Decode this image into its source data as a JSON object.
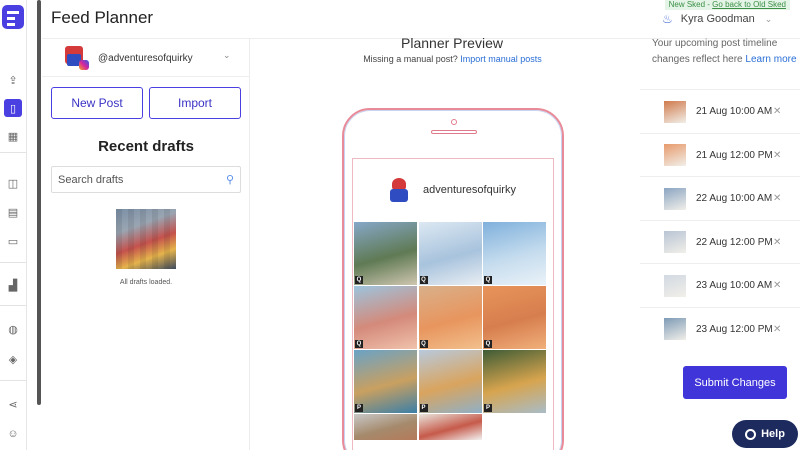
{
  "app": {
    "title": "Feed Planner"
  },
  "banner": {
    "prefix": "New Sked - ",
    "link": "Go back to Old Sked"
  },
  "user": {
    "name": "Kyra Goodman"
  },
  "account": {
    "handle": "@adventuresofquirky"
  },
  "drafts": {
    "new_post_label": "New Post",
    "import_label": "Import",
    "heading": "Recent drafts",
    "search_placeholder": "Search drafts",
    "loaded_text": "All drafts loaded."
  },
  "preview": {
    "heading": "Planner Preview",
    "missing_text": "Missing a manual post? ",
    "import_link": "Import manual posts",
    "profile_name": "adventuresofquirky",
    "tiles": [
      {
        "badge": "Q",
        "colors": [
          "#86a7c8",
          "#5f7a54",
          "#cfc6b0"
        ]
      },
      {
        "badge": "Q",
        "colors": [
          "#dce8f2",
          "#a8c3dd",
          "#e9eef3"
        ]
      },
      {
        "badge": "Q",
        "colors": [
          "#7fb0dc",
          "#c5dcee",
          "#eaf2f8"
        ]
      },
      {
        "badge": "Q",
        "colors": [
          "#9cc4de",
          "#d48a7a",
          "#f0c2ac"
        ]
      },
      {
        "badge": "Q",
        "colors": [
          "#d9b08a",
          "#e8955e",
          "#f2c08d"
        ]
      },
      {
        "badge": "Q",
        "colors": [
          "#e7945a",
          "#d77e4e",
          "#f0b07a"
        ]
      },
      {
        "badge": "P",
        "colors": [
          "#6aa2c6",
          "#c9a060",
          "#3b7fa8"
        ]
      },
      {
        "badge": "P",
        "colors": [
          "#b8c9dc",
          "#d9a45e",
          "#8fb0c8"
        ]
      },
      {
        "badge": "P",
        "colors": [
          "#3e5c36",
          "#d7a44e",
          "#a9bcc8"
        ]
      },
      {
        "badge": "",
        "colors": [
          "#c8c8c8",
          "#a58a6c",
          "#b57a5a"
        ]
      },
      {
        "badge": "",
        "colors": [
          "#e9e4dc",
          "#c65a4a",
          "#f2f2f2"
        ]
      }
    ]
  },
  "timeline": {
    "text": "Your upcoming post timeline changes reflect here ",
    "link": "Learn more",
    "items": [
      {
        "label": "21 Aug 10:00 AM",
        "remove": "✕",
        "color": "#d07a4c"
      },
      {
        "label": "21 Aug 12:00 PM",
        "remove": "✕",
        "color": "#e79a6c"
      },
      {
        "label": "22 Aug 10:00 AM",
        "remove": "✕",
        "color": "#8ba5c2"
      },
      {
        "label": "22 Aug 12:00 PM",
        "remove": "✕",
        "color": "#b8c4d4"
      },
      {
        "label": "23 Aug 10:00 AM",
        "remove": "✕",
        "color": "#d2d9e2"
      },
      {
        "label": "23 Aug 12:00 PM",
        "remove": "✕",
        "color": "#7e9bb6"
      }
    ],
    "submit_label": "Submit Changes"
  },
  "help": {
    "label": "Help"
  },
  "rail_icons": [
    "upload-icon",
    "phone-icon",
    "calendar-icon",
    "inbox-icon",
    "file-icon",
    "tray-icon",
    "analytics-icon",
    "palette-icon",
    "layers-icon",
    "share-icon",
    "user-icon"
  ]
}
